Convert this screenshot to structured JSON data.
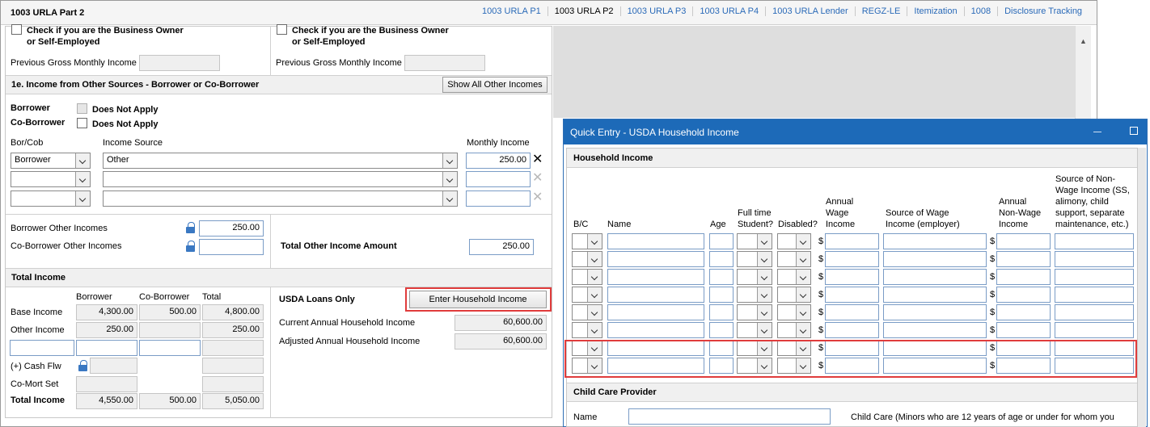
{
  "window": {
    "title": "1003 URLA Part 2",
    "tabs": [
      "1003 URLA P1",
      "1003 URLA P2",
      "1003 URLA P3",
      "1003 URLA P4",
      "1003 URLA Lender",
      "REGZ-LE",
      "Itemization",
      "1008",
      "Disclosure Tracking"
    ],
    "active_tab": "1003 URLA P2"
  },
  "self_employed": {
    "borrower_check_label_1": "Check if you are the Business Owner",
    "borrower_check_label_2": "or Self-Employed",
    "coborrower_check_label_1": "Check if you are the Business Owner",
    "coborrower_check_label_2": "or Self-Employed",
    "prev_gross_label_b": "Previous Gross Monthly Income",
    "prev_gross_label_c": "Previous Gross Monthly Income"
  },
  "other_income": {
    "header": "1e. Income from Other Sources - Borrower or Co-Borrower",
    "show_all_button": "Show All Other Incomes",
    "borrower_label": "Borrower",
    "coborrower_label": "Co-Borrower",
    "does_not_apply": "Does Not Apply",
    "col_borcob": "Bor/Cob",
    "col_source": "Income Source",
    "col_monthly": "Monthly Income",
    "rows": [
      {
        "borcob": "Borrower",
        "source": "Other",
        "amount": "250.00"
      },
      {
        "borcob": "",
        "source": "",
        "amount": ""
      },
      {
        "borcob": "",
        "source": "",
        "amount": ""
      }
    ],
    "borrower_other_label": "Borrower Other Incomes",
    "borrower_other_value": "250.00",
    "coborrower_other_label": "Co-Borrower Other Incomes",
    "coborrower_other_value": "",
    "total_label": "Total Other Income Amount",
    "total_value": "250.00"
  },
  "total_income": {
    "header": "Total Income",
    "col_borrower": "Borrower",
    "col_coborrower": "Co-Borrower",
    "col_total": "Total",
    "rows": [
      {
        "label": "Base Income",
        "b": "4,300.00",
        "c": "500.00",
        "t": "4,800.00"
      },
      {
        "label": "Other Income",
        "b": "250.00",
        "c": "",
        "t": "250.00"
      },
      {
        "label": "",
        "b": "",
        "c": "",
        "t": ""
      },
      {
        "label": "(+) Cash Flw",
        "b": "",
        "c": "",
        "t": ""
      },
      {
        "label": "Co-Mort Set",
        "b": "",
        "c": "",
        "t": ""
      },
      {
        "label": "Total Income",
        "b": "4,550.00",
        "c": "500.00",
        "t": "5,050.00"
      }
    ],
    "usda_label": "USDA Loans Only",
    "enter_household_button": "Enter Household Income",
    "current_annual_label": "Current Annual Household Income",
    "current_annual_value": "60,600.00",
    "adjusted_annual_label": "Adjusted Annual Household Income",
    "adjusted_annual_value": "60,600.00"
  },
  "dialog": {
    "title": "Quick Entry - USDA Household Income",
    "section": "Household Income",
    "columns": {
      "bc": "B/C",
      "name": "Name",
      "age": "Age",
      "student": [
        "Full time",
        "Student?"
      ],
      "disabled": "Disabled?",
      "wage": [
        "Annual",
        "Wage",
        "Income"
      ],
      "wage_source": [
        "Source of Wage",
        "Income (employer)"
      ],
      "nonwage": [
        "Annual",
        "Non-Wage",
        "Income"
      ],
      "nonwage_source": [
        "Source of Non-",
        "Wage Income (SS,",
        "alimony, child",
        "support, separate",
        "maintenance, etc.)"
      ]
    },
    "row_count": 8,
    "dollar": "$",
    "child_care_section": "Child Care Provider",
    "name_label": "Name",
    "child_care_note": "Child Care (Minors who are 12 years of age or under for whom you"
  },
  "colors": {
    "link": "#2a6ab8",
    "dialog_title_bar": "#1d6ab8",
    "highlight": "#e03c3c"
  }
}
